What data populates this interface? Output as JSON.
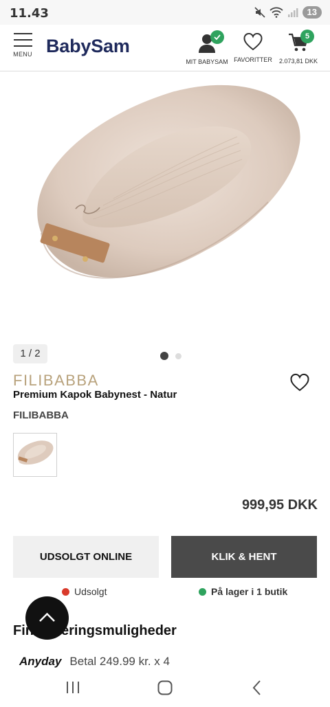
{
  "status_bar": {
    "time": "11.43",
    "battery": "13"
  },
  "header": {
    "menu_label": "MENU",
    "logo": "BabySam",
    "account_label": "MIT BABYSAM",
    "favorites_label": "FAVORITTER",
    "cart_total": "2.073,81 DKK",
    "cart_count": "5",
    "icons": [
      "menu-icon",
      "user-icon",
      "heart-icon",
      "cart-icon"
    ]
  },
  "gallery": {
    "counter": "1 / 2",
    "dots_total": 2,
    "active_dot": 1
  },
  "product": {
    "brand_logo": "FILIBABBA",
    "title": "Premium Kapok Babynest - Natur",
    "brand": "FILIBABBA",
    "price": "999,95 DKK"
  },
  "actions": {
    "online_label": "UDSOLGT ONLINE",
    "pickup_label": "KLIK & HENT"
  },
  "stock": {
    "online_status": "Udsolgt",
    "online_color": "#d93a2b",
    "store_status": "På lager i 1 butik",
    "store_color": "#2fa35e"
  },
  "financing": {
    "title": "Finansieringsmuligheder",
    "provider": "Anyday",
    "text": "Betal 249.99 kr. x 4"
  },
  "colors": {
    "brand": "#1f2a5c",
    "badge": "#2fa35e",
    "dark_button": "#4a4a4a"
  }
}
